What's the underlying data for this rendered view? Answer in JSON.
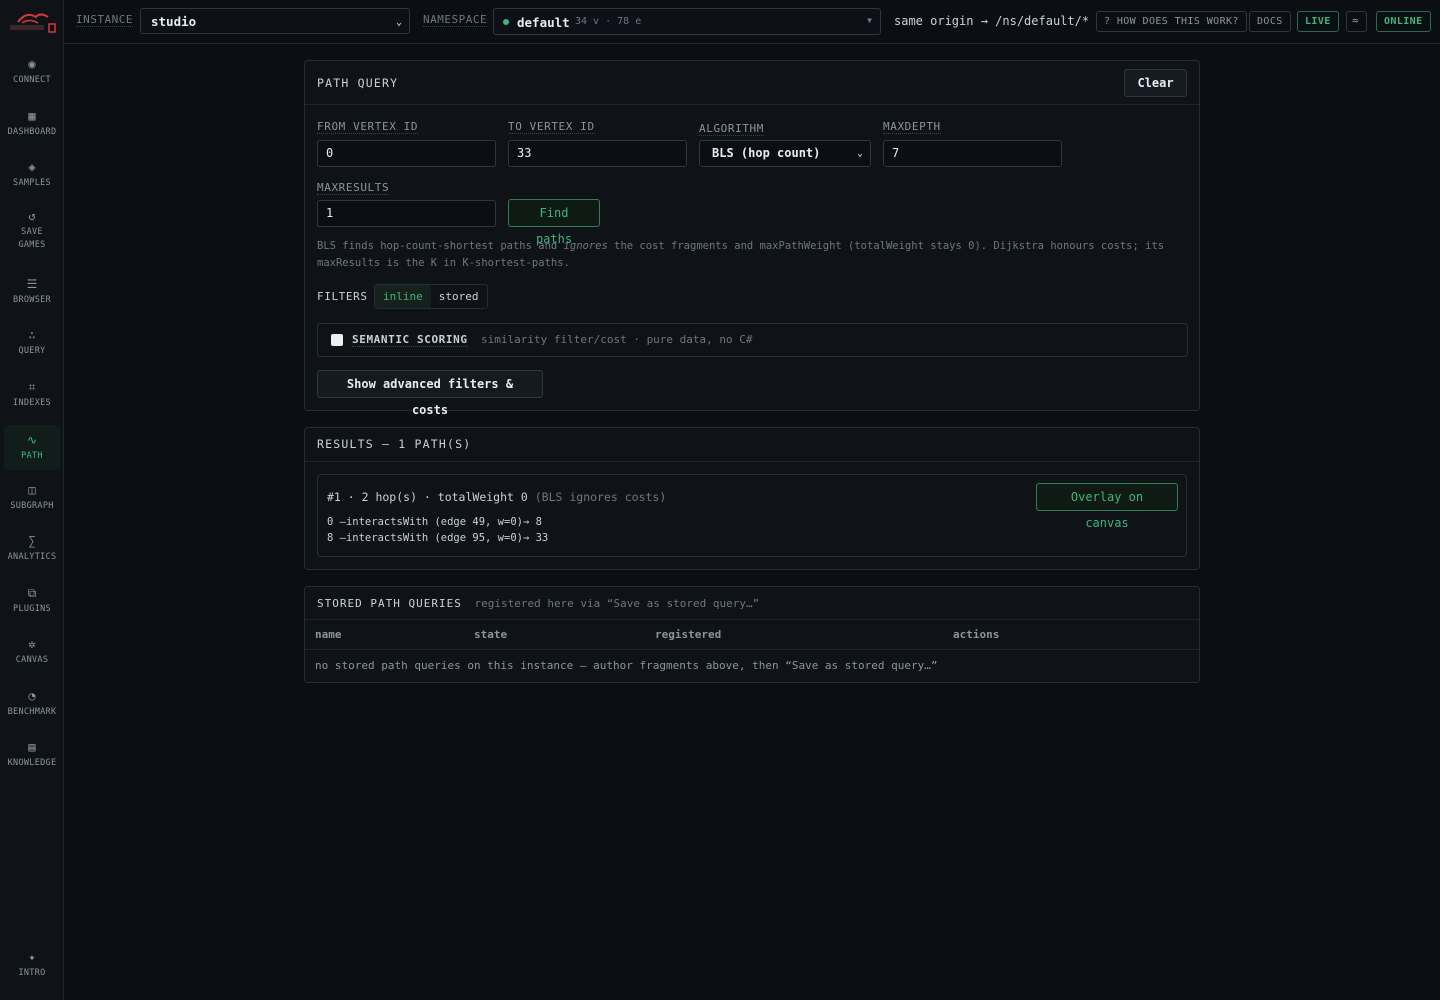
{
  "sidebar": {
    "items": [
      {
        "label": "CONNECT",
        "icon": "◉"
      },
      {
        "label": "DASHBOARD",
        "icon": "▦"
      },
      {
        "label": "SAMPLES",
        "icon": "◈"
      },
      {
        "label": "SAVE GAMES",
        "icon": "↺"
      },
      {
        "label": "BROWSER",
        "icon": "☰"
      },
      {
        "label": "QUERY",
        "icon": "∴"
      },
      {
        "label": "INDEXES",
        "icon": "⌗"
      },
      {
        "label": "PATH",
        "icon": "∿"
      },
      {
        "label": "SUBGRAPH",
        "icon": "◫"
      },
      {
        "label": "ANALYTICS",
        "icon": "∑"
      },
      {
        "label": "PLUGINS",
        "icon": "⧉"
      },
      {
        "label": "CANVAS",
        "icon": "✲"
      },
      {
        "label": "BENCHMARK",
        "icon": "◔"
      },
      {
        "label": "KNOWLEDGE",
        "icon": "▤"
      }
    ],
    "active": "PATH",
    "intro": {
      "label": "INTRO",
      "icon": "✦"
    }
  },
  "topbar": {
    "instance_label": "INSTANCE",
    "instance_value": "studio",
    "namespace_label": "NAMESPACE",
    "namespace_value": "default",
    "namespace_stats": "34 v · 78 e",
    "route": "same origin → /ns/default/*",
    "help": "? HOW DOES THIS WORK?",
    "docs": "DOCS",
    "live": "LIVE",
    "online": "ONLINE"
  },
  "path_query": {
    "title": "PATH QUERY",
    "clear": "Clear",
    "from_label": "FROM VERTEX ID",
    "from_value": "0",
    "to_label": "TO VERTEX ID",
    "to_value": "33",
    "algorithm_label": "ALGORITHM",
    "algorithm_value": "BLS (hop count)",
    "maxdepth_label": "MAXDEPTH",
    "maxdepth_value": "7",
    "maxresults_label": "MAXRESULTS",
    "maxresults_value": "1",
    "find": "Find paths",
    "note_a": "BLS finds hop-count-shortest paths and ",
    "note_em": "ignores",
    "note_b": " the cost fragments and maxPathWeight (totalWeight stays 0). Dijkstra honours costs; its",
    "note_line2": "maxResults is the K in K-shortest-paths.",
    "filters_label": "FILTERS",
    "filter_inline": "inline",
    "filter_stored": "stored",
    "semantic_title": "SEMANTIC SCORING",
    "semantic_desc": "similarity filter/cost · pure data, no C#",
    "advanced": "Show advanced filters & costs"
  },
  "results": {
    "title": "RESULTS — 1 PATH(S)",
    "path": {
      "head": "#1 · 2 hop(s) · totalWeight 0",
      "note": "(BLS ignores costs)",
      "hops": [
        "0 —interactsWith (edge 49, w=0)→ 8",
        "8 —interactsWith (edge 95, w=0)→ 33"
      ],
      "overlay": "Overlay on canvas"
    }
  },
  "stored": {
    "title": "STORED PATH QUERIES",
    "subtitle": "registered here via “Save as stored query…”",
    "columns": [
      "name",
      "state",
      "registered",
      "actions"
    ],
    "empty": "no stored path queries on this instance — author fragments above, then “Save as stored query…”"
  },
  "colors": {
    "accent": "#3fb57a",
    "background": "#0b0e12",
    "panel": "#0f1318"
  }
}
